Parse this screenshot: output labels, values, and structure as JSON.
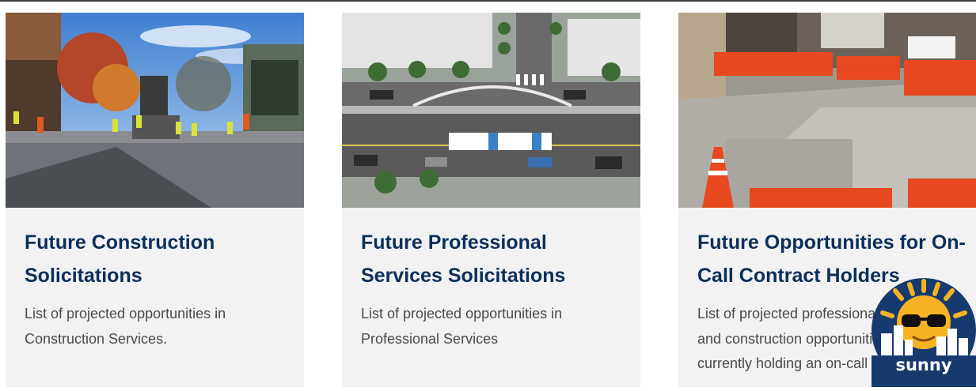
{
  "cards": [
    {
      "title": "Future Construction Solicitations",
      "description": "List of projected opportunities in Construction Services."
    },
    {
      "title": "Future Professional Services Solicitations",
      "description": "List of projected opportunities in Professional Services"
    },
    {
      "title": "Future Opportunities for On-Call Contract Holders",
      "description": "List of projected professional services and construction opportunities for firms currently holding an on-call contract."
    }
  ],
  "chat_widget": {
    "label": "sunny",
    "icon": "sun-with-sunglasses-icon"
  },
  "colors": {
    "title": "#0b2f5b",
    "body_text": "#4a4a4a",
    "card_bg": "#f2f2f2",
    "widget_navy": "#163a6e",
    "widget_sun": "#f5b324"
  }
}
